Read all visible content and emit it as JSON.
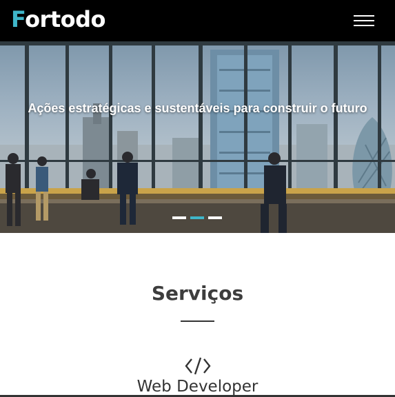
{
  "header": {
    "logo_initial": "F",
    "logo_rest": "ortodo",
    "menu_icon": "hamburger-menu-icon",
    "accent_color": "#3fb6c9"
  },
  "hero": {
    "title": "Ações estratégicas e sustentáveis para construir o futuro",
    "slides": [
      {
        "active": false
      },
      {
        "active": true
      },
      {
        "active": false
      }
    ]
  },
  "services": {
    "title": "Serviços",
    "items": [
      {
        "icon": "code-icon",
        "label": "Web Developer"
      }
    ]
  }
}
